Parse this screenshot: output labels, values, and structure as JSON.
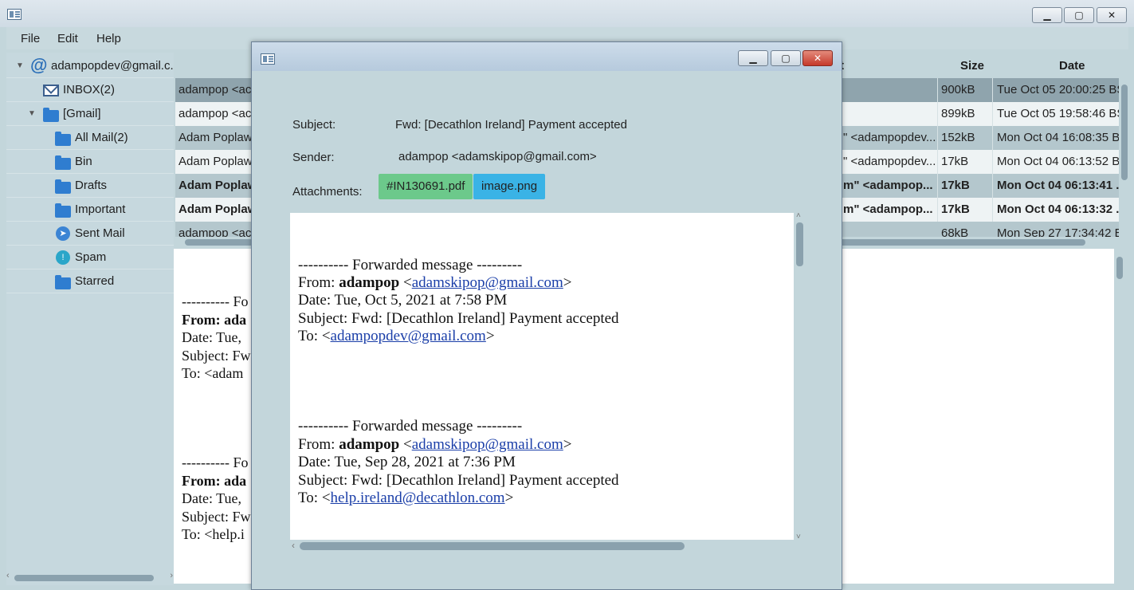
{
  "menu": {
    "file": "File",
    "edit": "Edit",
    "help": "Help"
  },
  "sidebar": {
    "account": "adampopdev@gmail.c...",
    "items": [
      {
        "label": "INBOX(2)",
        "icon": "mail-icon"
      },
      {
        "label": "[Gmail]",
        "icon": "folder-icon"
      },
      {
        "label": "All Mail(2)",
        "icon": "folder-icon"
      },
      {
        "label": "Bin",
        "icon": "folder-icon"
      },
      {
        "label": "Drafts",
        "icon": "folder-icon"
      },
      {
        "label": "Important",
        "icon": "folder-icon"
      },
      {
        "label": "Sent Mail",
        "icon": "send-icon"
      },
      {
        "label": "Spam",
        "icon": "spam-icon"
      },
      {
        "label": "Starred",
        "icon": "folder-icon"
      }
    ]
  },
  "table": {
    "headers": {
      "recipient_tail": "t",
      "size": "Size",
      "date": "Date"
    },
    "rows": [
      {
        "sender": "adampop <ac",
        "recipient": "",
        "size": "900kB",
        "date": "Tue Oct 05 20:00:25 BS"
      },
      {
        "sender": "adampop <ac",
        "recipient": "",
        "size": "899kB",
        "date": "Tue Oct 05 19:58:46 BS"
      },
      {
        "sender": "Adam Poplaw",
        "recipient": "\" <adampopdev...",
        "size": "152kB",
        "date": "Mon Oct 04 16:08:35 BS"
      },
      {
        "sender": "Adam Poplaw",
        "recipient": "\" <adampopdev...",
        "size": "17kB",
        "date": "Mon Oct 04 06:13:52 BS"
      },
      {
        "sender": "Adam Poplaw",
        "recipient": "m\" <adampop...",
        "size": "17kB",
        "date": "Mon Oct 04 06:13:41 ..."
      },
      {
        "sender": "Adam Poplaw",
        "recipient": "m\" <adampop...",
        "size": "17kB",
        "date": "Mon Oct 04 06:13:32 ..."
      },
      {
        "sender": "adampop <ac",
        "recipient": "",
        "size": "68kB",
        "date": "Mon Sep 27 17:34:42 B"
      }
    ]
  },
  "preview": {
    "lines": [
      "---------- Fo",
      "From: ada",
      "Date: Tue,",
      "Subject: Fw",
      "To: <adam",
      "---------- Fo",
      "From: ada",
      "Date: Tue,",
      "Subject: Fw",
      "To: <help.i"
    ]
  },
  "dialog": {
    "subject_label": "Subject:",
    "subject_value": "Fwd: [Decathlon Ireland] Payment accepted",
    "sender_label": "Sender:",
    "sender_value": "adampop <adamskipop@gmail.com>",
    "attachments_label": "Attachments:",
    "attachments": [
      "#IN130691.pdf",
      "image.png"
    ],
    "attachment_colors": [
      "#6cc98b",
      "#3ab3e6"
    ],
    "body": {
      "block1": {
        "separator": "---------- Forwarded message ---------",
        "from_prefix": "From: ",
        "from_name": "adampop",
        "from_email": "adamskipop@gmail.com",
        "date": "Date: Tue, Oct 5, 2021 at 7:58 PM",
        "subject": "Subject: Fwd: [Decathlon Ireland] Payment accepted",
        "to_prefix": "To: ",
        "to_email": "adampopdev@gmail.com"
      },
      "block2": {
        "separator": "---------- Forwarded message ---------",
        "from_prefix": "From: ",
        "from_name": "adampop",
        "from_email": "adamskipop@gmail.com",
        "date": "Date: Tue, Sep 28, 2021 at 7:36 PM",
        "subject": "Subject: Fwd: [Decathlon Ireland] Payment accepted",
        "to_prefix": "To: ",
        "to_email": "help.ireland@decathlon.com"
      }
    }
  }
}
